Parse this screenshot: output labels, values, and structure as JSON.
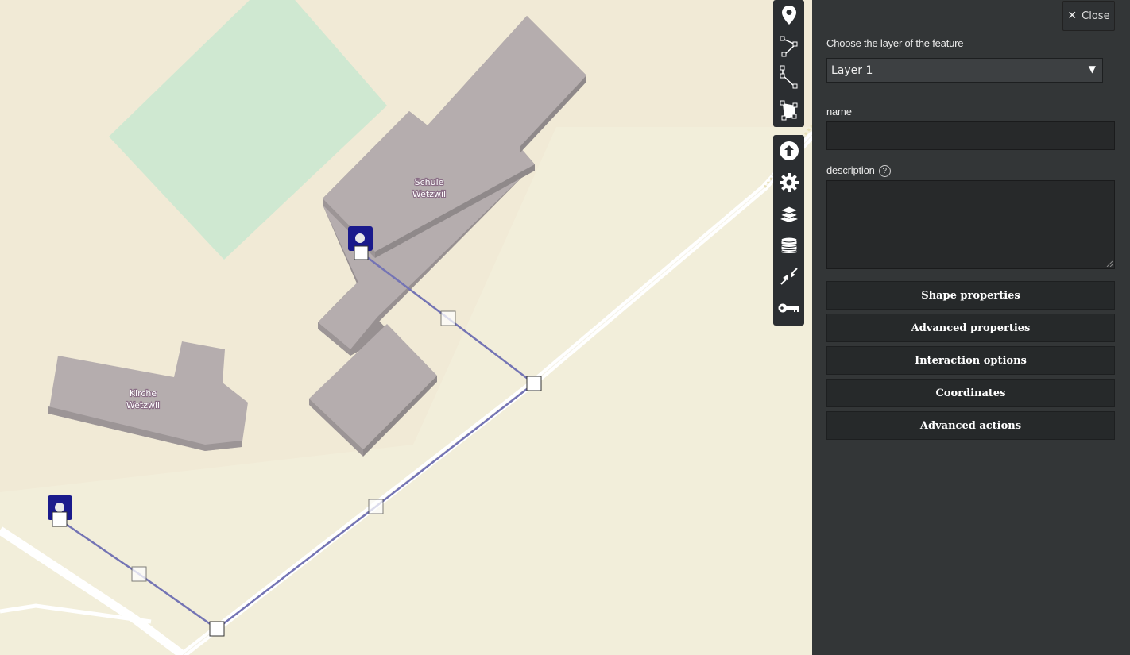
{
  "map": {
    "buildings": [
      {
        "label_line1": "Schule",
        "label_line2": "Wetzwil"
      },
      {
        "label_line1": "Kirche",
        "label_line2": "Wetzwil"
      }
    ],
    "marker_icons": [
      "map-marker-icon",
      "map-marker-icon"
    ],
    "colors": {
      "background": "#f2eeda",
      "park": "#cfe8d1",
      "building_top": "#b5adae",
      "building_side": "#979091",
      "road": "#ffffff",
      "route_line": "#7474b4",
      "marker": "#1a1a8c"
    }
  },
  "toolbar": {
    "draw_tools": [
      {
        "name": "draw-marker-button",
        "icon": "map-pin-icon"
      },
      {
        "name": "draw-line-button",
        "icon": "polyline-icon"
      },
      {
        "name": "draw-multiline-button",
        "icon": "multi-polyline-icon"
      },
      {
        "name": "draw-polygon-button",
        "icon": "polygon-icon"
      }
    ],
    "map_tools": [
      {
        "name": "import-data-button",
        "icon": "upload-icon"
      },
      {
        "name": "map-settings-button",
        "icon": "gear-icon"
      },
      {
        "name": "manage-layers-button",
        "icon": "layers-icon"
      },
      {
        "name": "datalayers-button",
        "icon": "database-icon"
      },
      {
        "name": "map-extent-button",
        "icon": "collapse-arrows-icon"
      },
      {
        "name": "permissions-button",
        "icon": "key-icon"
      }
    ]
  },
  "panel": {
    "close_label": "Close",
    "layer_prompt": "Choose the layer of the feature",
    "layer_selected": "Layer 1",
    "name_label": "name",
    "name_value": "",
    "description_label": "description",
    "description_value": "",
    "sections": [
      "Shape properties",
      "Advanced properties",
      "Interaction options",
      "Coordinates",
      "Advanced actions"
    ]
  }
}
